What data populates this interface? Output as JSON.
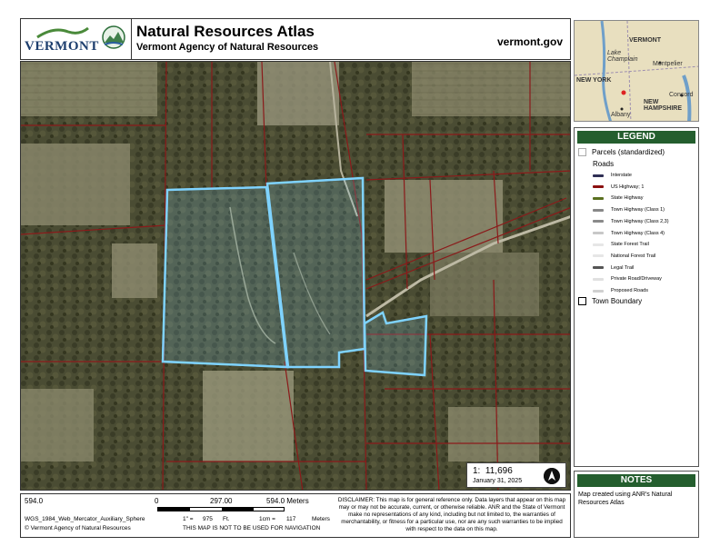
{
  "header": {
    "logo_text": "VERMONT",
    "title": "Natural Resources Atlas",
    "subtitle": "Vermont Agency of Natural Resources",
    "website": "vermont.gov"
  },
  "colors": {
    "parcel_line": "#8b1a1a",
    "highlight": "#7fd3ff",
    "legend_header": "#245e2e"
  },
  "scale_box": {
    "ratio_prefix": "1:",
    "ratio": "11,696",
    "date": "January 31, 2025"
  },
  "locator": {
    "labels": [
      "VERMONT",
      "Lake Champlain",
      "Montpelier",
      "NEW YORK",
      "NEW HAMPSHIRE",
      "Concord",
      "Albany"
    ]
  },
  "legend": {
    "title": "LEGEND",
    "parcels_label": "Parcels (standardized)",
    "roads_label": "Roads",
    "road_items": [
      {
        "label": "Interstate",
        "color": "#2f2f55"
      },
      {
        "label": "US Highway; 1",
        "color": "#8b1010"
      },
      {
        "label": "State Highway",
        "color": "#5a7020"
      },
      {
        "label": "Town Highway (Class 1)",
        "color": "#888888"
      },
      {
        "label": "Town Highway (Class 2,3)",
        "color": "#8a8a8a"
      },
      {
        "label": "Town Highway (Class 4)",
        "color": "#c8c8c8"
      },
      {
        "label": "State Forest Trail",
        "color": "#e6e6e6"
      },
      {
        "label": "National Forest Trail",
        "color": "#e6e6e6"
      },
      {
        "label": "Legal Trail",
        "color": "#555555"
      },
      {
        "label": "Private Road/Driveway",
        "color": "#e0e0e0"
      },
      {
        "label": "Proposed Roads",
        "color": "#d0d0d0"
      }
    ],
    "town_boundary_label": "Town Boundary"
  },
  "notes": {
    "title": "NOTES",
    "text": "Map created using ANR's Natural Resources Atlas"
  },
  "footer": {
    "scale_left": "594.0",
    "scale_zero": "0",
    "scale_mid": "297.00",
    "scale_right": "594.0 Meters",
    "projection": "WGS_1984_Web_Mercator_Auxiliary_Sphere",
    "copyright": "© Vermont Agency of Natural Resources",
    "inch_label": "1\" =",
    "inch_value": "975",
    "inch_unit": "Ft.",
    "cm_label": "1cm =",
    "cm_value": "117",
    "cm_unit": "Meters",
    "nav_warning": "THIS MAP IS NOT TO BE USED FOR NAVIGATION",
    "disclaimer": "DISCLAIMER: This map is for general reference only. Data layers that appear on this map may or may not be accurate, current, or otherwise reliable. ANR and the State of Vermont make no representations of any kind, including but not limited to, the warranties of merchantability, or fitness for a particular use, nor are any such warranties to be implied with respect to the data on this map."
  }
}
